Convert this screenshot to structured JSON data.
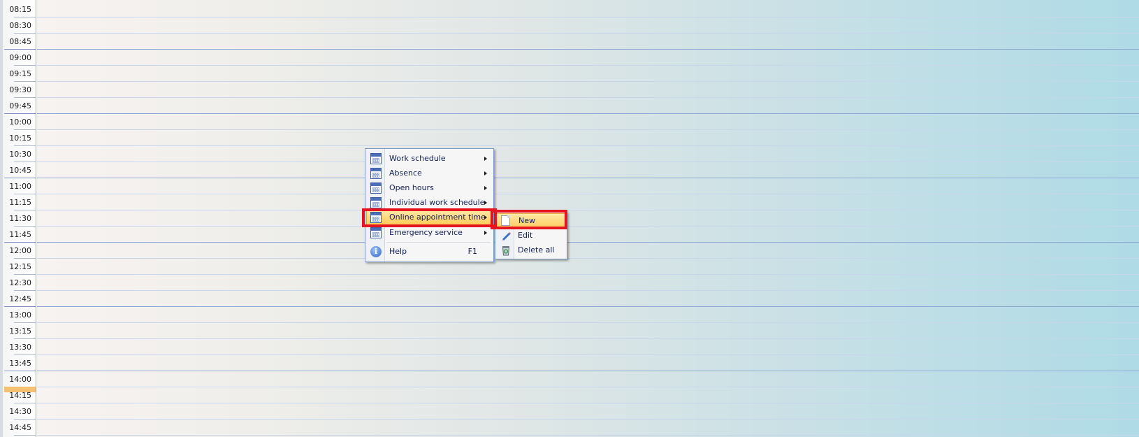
{
  "time_slots": [
    {
      "label": "08:15",
      "hour_line": false
    },
    {
      "label": "08:30",
      "hour_line": false
    },
    {
      "label": "08:45",
      "hour_line": true
    },
    {
      "label": "09:00",
      "hour_line": false
    },
    {
      "label": "09:15",
      "hour_line": false
    },
    {
      "label": "09:30",
      "hour_line": false
    },
    {
      "label": "09:45",
      "hour_line": true
    },
    {
      "label": "10:00",
      "hour_line": false
    },
    {
      "label": "10:15",
      "hour_line": false
    },
    {
      "label": "10:30",
      "hour_line": false
    },
    {
      "label": "10:45",
      "hour_line": true
    },
    {
      "label": "11:00",
      "hour_line": false
    },
    {
      "label": "11:15",
      "hour_line": false
    },
    {
      "label": "11:30",
      "hour_line": false
    },
    {
      "label": "11:45",
      "hour_line": true
    },
    {
      "label": "12:00",
      "hour_line": false
    },
    {
      "label": "12:15",
      "hour_line": false
    },
    {
      "label": "12:30",
      "hour_line": false
    },
    {
      "label": "12:45",
      "hour_line": true
    },
    {
      "label": "13:00",
      "hour_line": false
    },
    {
      "label": "13:15",
      "hour_line": false
    },
    {
      "label": "13:30",
      "hour_line": false
    },
    {
      "label": "13:45",
      "hour_line": true
    },
    {
      "label": "14:00",
      "hour_line": false,
      "current": true
    },
    {
      "label": "14:15",
      "hour_line": false
    },
    {
      "label": "14:30",
      "hour_line": false
    },
    {
      "label": "14:45",
      "hour_line": false
    }
  ],
  "context_menu": {
    "items": [
      {
        "label": "Work schedule",
        "icon": "calendar-icon",
        "has_submenu": true
      },
      {
        "label": "Absence",
        "icon": "calendar-icon",
        "has_submenu": true
      },
      {
        "label": "Open hours",
        "icon": "calendar-icon",
        "has_submenu": true
      },
      {
        "label": "Individual work schedule",
        "icon": "calendar-icon",
        "has_submenu": true
      },
      {
        "label": "Online appointment time",
        "icon": "calendar-icon",
        "has_submenu": true,
        "highlighted": true
      },
      {
        "label": "Emergency service",
        "icon": "calendar-icon",
        "has_submenu": true
      },
      {
        "label": "Help",
        "icon": "help-icon",
        "shortcut": "F1"
      }
    ]
  },
  "submenu": {
    "items": [
      {
        "label": "New",
        "icon": "document-icon",
        "highlighted": true
      },
      {
        "label": "Edit",
        "icon": "pencil-icon"
      },
      {
        "label": "Delete all",
        "icon": "recycle-bin-icon"
      }
    ]
  },
  "colors": {
    "highlight_frame": "#e6141e",
    "menu_highlight": "#ffcd5a",
    "current_time_marker": "#f5c072",
    "calendar_gradient_end": "#afdbe6"
  }
}
